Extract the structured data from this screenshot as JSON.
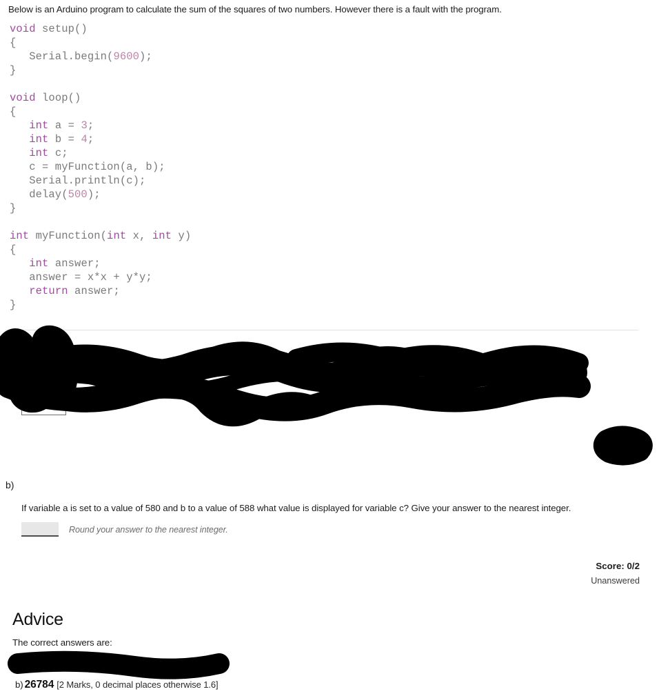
{
  "intro": {
    "text": "Below is an Arduino program to calculate the sum of the squares of two numbers. However there is a fault with the program."
  },
  "code": {
    "language": "arduino",
    "lines": [
      [
        {
          "t": "void",
          "c": "kw"
        },
        {
          "t": " setup",
          "c": "pn"
        },
        {
          "t": "()",
          "c": "pn"
        }
      ],
      [
        {
          "t": "{",
          "c": "pn"
        }
      ],
      [
        {
          "t": "   Serial.begin(",
          "c": "pn"
        },
        {
          "t": "9600",
          "c": "num"
        },
        {
          "t": ");",
          "c": "pn"
        }
      ],
      [
        {
          "t": "}",
          "c": "pn"
        }
      ],
      [],
      [
        {
          "t": "void",
          "c": "kw"
        },
        {
          "t": " loop",
          "c": "pn"
        },
        {
          "t": "()",
          "c": "pn"
        }
      ],
      [
        {
          "t": "{",
          "c": "pn"
        }
      ],
      [
        {
          "t": "   ",
          "c": "pn"
        },
        {
          "t": "int",
          "c": "kw"
        },
        {
          "t": " a = ",
          "c": "pn"
        },
        {
          "t": "3",
          "c": "num"
        },
        {
          "t": ";",
          "c": "pn"
        }
      ],
      [
        {
          "t": "   ",
          "c": "pn"
        },
        {
          "t": "int",
          "c": "kw"
        },
        {
          "t": " b = ",
          "c": "pn"
        },
        {
          "t": "4",
          "c": "num"
        },
        {
          "t": ";",
          "c": "pn"
        }
      ],
      [
        {
          "t": "   ",
          "c": "pn"
        },
        {
          "t": "int",
          "c": "kw"
        },
        {
          "t": " c;",
          "c": "pn"
        }
      ],
      [
        {
          "t": "   c = myFunction(a, b);",
          "c": "pn"
        }
      ],
      [
        {
          "t": "   Serial.println(c);",
          "c": "pn"
        }
      ],
      [
        {
          "t": "   delay(",
          "c": "pn"
        },
        {
          "t": "500",
          "c": "num"
        },
        {
          "t": ");",
          "c": "pn"
        }
      ],
      [
        {
          "t": "}",
          "c": "pn"
        }
      ],
      [],
      [
        {
          "t": "int",
          "c": "kw"
        },
        {
          "t": " myFunction(",
          "c": "pn"
        },
        {
          "t": "int",
          "c": "kw"
        },
        {
          "t": " x, ",
          "c": "pn"
        },
        {
          "t": "int",
          "c": "kw"
        },
        {
          "t": " y)",
          "c": "pn"
        }
      ],
      [
        {
          "t": "{",
          "c": "pn"
        }
      ],
      [
        {
          "t": "   ",
          "c": "pn"
        },
        {
          "t": "int",
          "c": "kw"
        },
        {
          "t": " answer;",
          "c": "pn"
        }
      ],
      [
        {
          "t": "   answer = x*x + y*y;",
          "c": "pn"
        }
      ],
      [
        {
          "t": "   ",
          "c": "pn"
        },
        {
          "t": "return",
          "c": "kw"
        },
        {
          "t": " answer;",
          "c": "pn"
        }
      ],
      [
        {
          "t": "}",
          "c": "pn"
        }
      ]
    ]
  },
  "part_b": {
    "label": "b)",
    "question": "If variable a is set to a value of 580 and b to a value of 588 what value is displayed for variable c? Give your answer to the nearest integer.",
    "answer_value": "",
    "answer_placeholder": "",
    "hint": "Round your answer to the nearest integer."
  },
  "score": {
    "value": "Score: 0/2",
    "state": "Unanswered"
  },
  "advice": {
    "title": "Advice",
    "intro": "The correct answers are:",
    "answer_label": "b)",
    "answer_value": "26784",
    "answer_meta": "[2 Marks, 0 decimal places otherwise 1.6]"
  },
  "colors": {
    "keyword": "#a04ba0",
    "number": "#bb84a6",
    "code_plain": "#6f6f6f",
    "redaction": "#000000",
    "input_outline": "#2e7fc1",
    "rule": "#e2e2e2"
  }
}
